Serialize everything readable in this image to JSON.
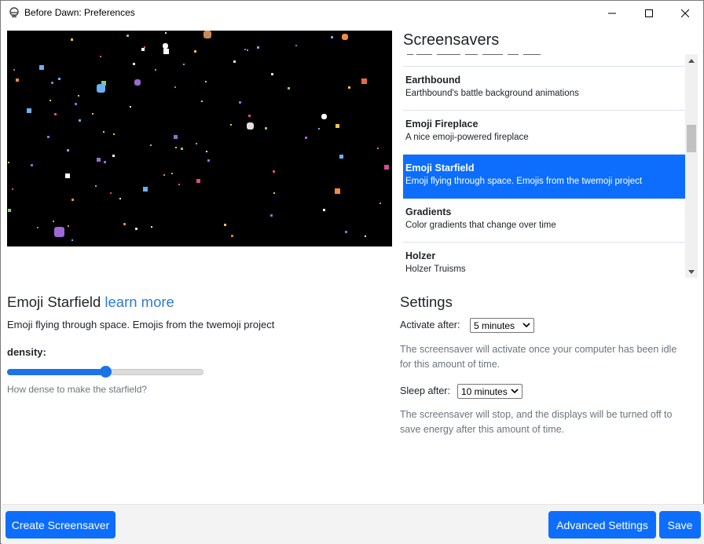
{
  "window": {
    "title": "Before Dawn: Preferences"
  },
  "screensavers": {
    "title": "Screensavers",
    "items": [
      {
        "name": "Earthbound",
        "description": "Earthbound's battle background animations",
        "selected": false
      },
      {
        "name": "Emoji Fireplace",
        "description": "A nice emoji-powered fireplace",
        "selected": false
      },
      {
        "name": "Emoji Starfield",
        "description": "Emoji flying through space. Emojis from the twemoji project",
        "selected": true
      },
      {
        "name": "Gradients",
        "description": "Color gradients that change over time",
        "selected": false
      },
      {
        "name": "Holzer",
        "description": "Holzer Truisms",
        "selected": false
      }
    ]
  },
  "details": {
    "name": "Emoji Starfield",
    "learn_more": "learn more",
    "description": "Emoji flying through space. Emojis from the twemoji project",
    "density_label": "density:",
    "density_value": 0.5,
    "density_help": "How dense to make the starfield?"
  },
  "settings": {
    "title": "Settings",
    "activate_label": "Activate after:",
    "activate_value": "5 minutes",
    "activate_help": "The screensaver will activate once your computer has been idle for this amount of time.",
    "sleep_label": "Sleep after:",
    "sleep_value": "10 minutes",
    "sleep_help": "The screensaver will stop, and the displays will be turned off to save energy after this amount of time."
  },
  "footer": {
    "create_label": "Create Screensaver",
    "advanced_label": "Advanced Settings",
    "save_label": "Save"
  },
  "colors": {
    "accent": "#0d6efd",
    "link": "#2b7bd6",
    "muted": "#6c757d"
  }
}
